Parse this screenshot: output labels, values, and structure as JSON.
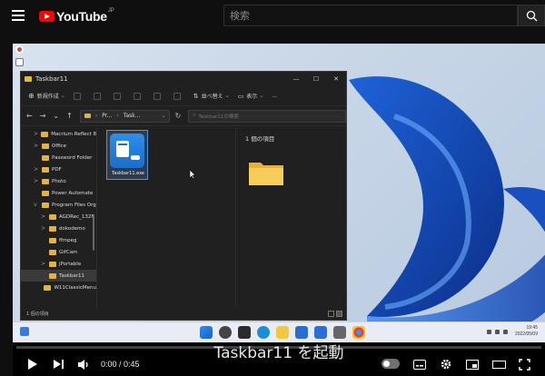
{
  "header": {
    "logo_text": "YouTube",
    "region": "JP",
    "search_placeholder": "検索"
  },
  "explorer": {
    "title": "Taskbar11",
    "toolbar": {
      "new_label": "新規作成",
      "sort_label": "並べ替え",
      "view_label": "表示",
      "more_label": "..."
    },
    "address": {
      "crumbs": [
        "Pr...",
        "Task..."
      ],
      "search_placeholder": "Taskbar11の検索"
    },
    "nav_items": [
      {
        "label": "Macrium Reflect 8",
        "level": 0,
        "expand": ">"
      },
      {
        "label": "Office",
        "level": 0,
        "expand": ">"
      },
      {
        "label": "Password Folder",
        "level": 0,
        "expand": ""
      },
      {
        "label": "PDF",
        "level": 0,
        "expand": ">"
      },
      {
        "label": "Photo",
        "level": 0,
        "expand": ">"
      },
      {
        "label": "Power Automate",
        "level": 0,
        "expand": ""
      },
      {
        "label": "Program Files Org",
        "level": 0,
        "expand": "v"
      },
      {
        "label": "AGDRec_132F",
        "level": 1,
        "expand": ">"
      },
      {
        "label": "dokodemo",
        "level": 1,
        "expand": ">"
      },
      {
        "label": "ffmpeg",
        "level": 1,
        "expand": ""
      },
      {
        "label": "GifCam",
        "level": 1,
        "expand": ""
      },
      {
        "label": "jPortable",
        "level": 1,
        "expand": ">"
      },
      {
        "label": "Taskbar11",
        "level": 1,
        "expand": "",
        "selected": true
      },
      {
        "label": "W11ClassicMenu",
        "level": 1,
        "expand": ""
      }
    ],
    "file": {
      "name": "Taskbar11.exe"
    },
    "preview_count": "1 個の項目",
    "status": "1 個の項目"
  },
  "taskbar": {
    "time": "19:45",
    "date": "2022/05/09"
  },
  "video": {
    "caption": "Taskbar11 を起動",
    "time_display": "0:00 / 0:45",
    "progress": 0
  }
}
